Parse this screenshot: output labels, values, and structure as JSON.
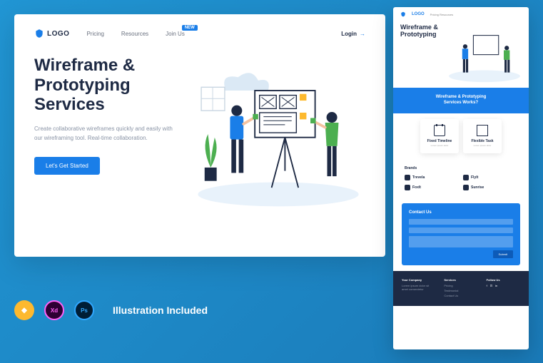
{
  "logo_text": "LOGO",
  "nav": {
    "pricing": "Pricing",
    "resources": "Resources",
    "join": "Join Us",
    "badge": "NEW",
    "login": "Login"
  },
  "hero": {
    "title_l1": "Wireframe &",
    "title_l2": "Prototyping",
    "title_l3": "Services",
    "desc": "Create collaborative wireframes quickly and easily with our wireframing tool. Real-time collaboration.",
    "cta": "Let's Get Started"
  },
  "tools": {
    "sketch": "◆",
    "xd": "Xd",
    "ps": "Ps",
    "included": "Illustration Included"
  },
  "preview": {
    "logo": "LOGO",
    "nav_items": "Pricing   Resources",
    "hero_title": "Wireframe & Prototyping",
    "blue_title_l1": "Wireframe &  Prototyping",
    "blue_title_l2": "Services Works?",
    "card1_title": "Fixed Timeline",
    "card1_desc": "Lorem ipsum dolor",
    "card2_title": "Flexible Task",
    "card2_desc": "Lorem ipsum dolor",
    "brands_title": "Brands",
    "brand1": "Trevela",
    "brand2": "FlyIt",
    "brand3": "FoxIt",
    "brand4": "Sunrise",
    "contact_title": "Contact Us",
    "submit": "Submit",
    "footer_col1_title": "Your Company",
    "footer_col1_desc": "Lorem ipsum dolor sit amet consectetur",
    "footer_col2_title": "Services",
    "footer_col2_i1": "Pricing",
    "footer_col2_i2": "Testimonial",
    "footer_col2_i3": "Contact Us",
    "footer_col3_title": "Follow Us"
  }
}
